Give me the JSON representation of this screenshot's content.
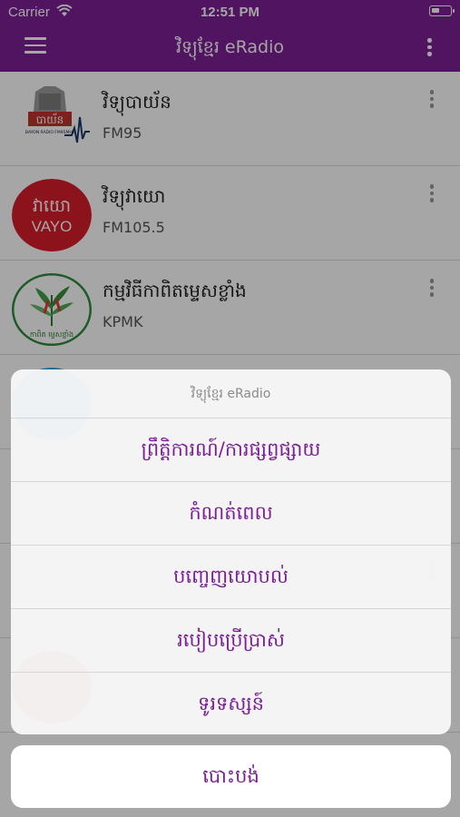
{
  "status_bar": {
    "carrier": "Carrier",
    "time": "12:51 PM"
  },
  "header": {
    "title": "វិទ្យុខ្មែរ eRadio",
    "menu_icon": "menu-icon",
    "more_icon": "more-icon"
  },
  "stations": [
    {
      "name": "វិទ្យុបាយ័ន",
      "subtitle": "FM95",
      "logo_text": "បាយ័ន",
      "logo_subtext": "BAYON RADIO FM95MHz"
    },
    {
      "name": "វិទ្យុវាយោ",
      "subtitle": "FM105.5",
      "logo_text": "វាយោ",
      "logo_subtext": "VAYO"
    },
    {
      "name": "កម្មវិធីកាពិតម្ទេសខ្លាំង",
      "subtitle": "KPMK",
      "logo_text": "កាពិត ម្ទេសខ្លាំង"
    }
  ],
  "action_sheet": {
    "title": "វិទ្យុខ្មែរ eRadio",
    "options": [
      "ព្រឹត្តិការណ៍/ការផ្សព្វផ្សាយ",
      "កំណត់ពេល",
      "បញ្ចេញយោបល់",
      "របៀបប្រើប្រាស់",
      "ទូរទស្សន៍"
    ],
    "cancel": "បោះបង់"
  },
  "colors": {
    "accent": "#7b2094",
    "vayo_red": "#d71e2b"
  }
}
